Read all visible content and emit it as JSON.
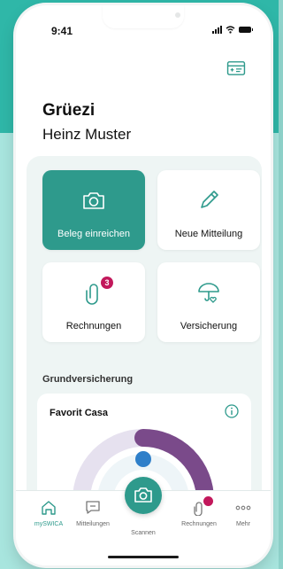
{
  "status": {
    "time": "9:41"
  },
  "greeting": {
    "hello": "Grüezi",
    "name": "Heinz Muster"
  },
  "tiles": [
    {
      "label": "Beleg einreichen",
      "icon": "camera-icon"
    },
    {
      "label": "Neue Mitteilung",
      "icon": "pencil-icon"
    },
    {
      "label": "Rechnungen",
      "icon": "paperclip-icon",
      "badge": "3"
    },
    {
      "label": "Versicherung",
      "icon": "umbrella-heart-icon"
    }
  ],
  "section": {
    "title": "Grundversicherung"
  },
  "insurance_card": {
    "title": "Favorit Casa"
  },
  "tabbar": {
    "items": [
      {
        "label": "mySWICA",
        "icon": "home-icon"
      },
      {
        "label": "Mitteilungen",
        "icon": "chat-icon"
      },
      {
        "label": "Scannen",
        "icon": "camera-icon"
      },
      {
        "label": "Rechnungen",
        "icon": "paperclip-icon",
        "badge": ""
      },
      {
        "label": "Mehr",
        "icon": "more-icon"
      }
    ]
  },
  "colors": {
    "primary": "#2e9a8c",
    "badge": "#c2185b",
    "arc": "#7a4a8a",
    "arc_track": "#e6e1ef"
  }
}
